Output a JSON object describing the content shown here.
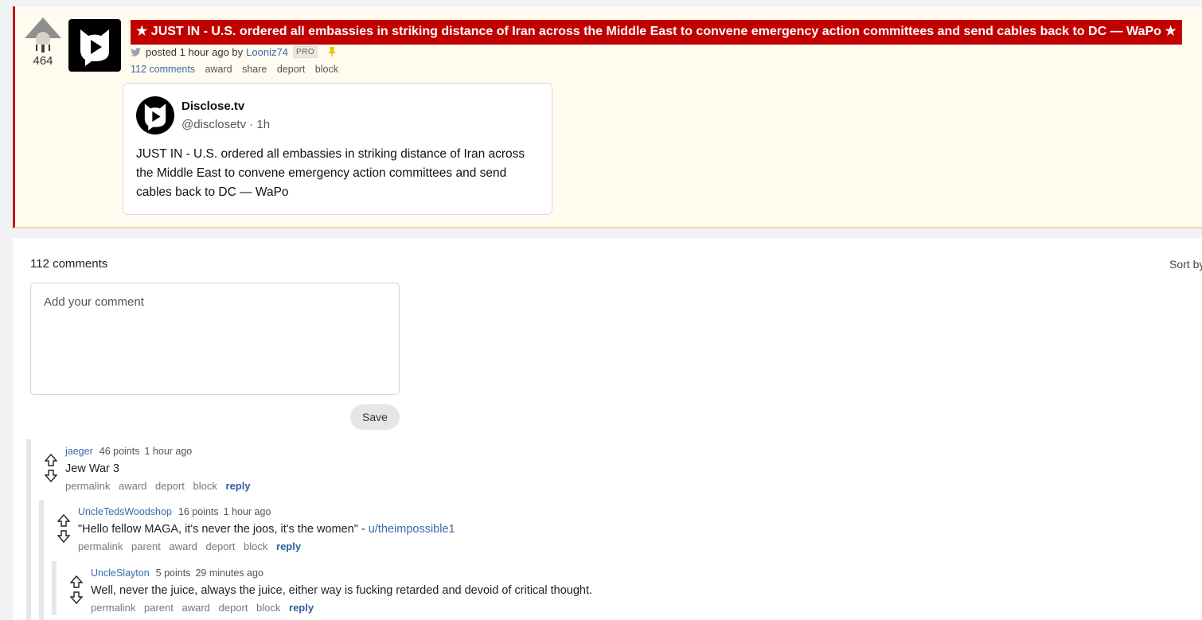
{
  "post": {
    "score": "464",
    "title": "★ JUST IN - U.S. ordered all embassies in striking distance of Iran across the Middle East to convene emergency action committees and send cables back to DC — WaPo ★",
    "posted_text": "posted 1 hour ago by",
    "author": "Looniz74",
    "badge": "PRO",
    "actions": {
      "comments": "112 comments",
      "award": "award",
      "share": "share",
      "deport": "deport",
      "block": "block"
    },
    "tweet": {
      "name": "Disclose.tv",
      "handle": "@disclosetv · 1h",
      "text": "JUST IN - U.S. ordered all embassies in striking distance of Iran across the Middle East to convene emergency action committees and send cables back to DC — WaPo"
    }
  },
  "comments_section": {
    "count_label": "112 comments",
    "sort_label": "Sort by",
    "input_placeholder": "Add your comment",
    "save_label": "Save",
    "comments": [
      {
        "user": "jaeger",
        "points": "46 points",
        "time": "1 hour ago",
        "body": "Jew War 3",
        "actions": [
          "permalink",
          "award",
          "deport",
          "block",
          "reply"
        ]
      },
      {
        "user": "UncleTedsWoodshop",
        "points": "16 points",
        "time": "1 hour ago",
        "body": "\"Hello fellow MAGA, it's never the joos, it's the women\" - ",
        "link": "u/theimpossible1",
        "actions": [
          "permalink",
          "parent",
          "award",
          "deport",
          "block",
          "reply"
        ]
      },
      {
        "user": "UncleSlayton",
        "points": "5 points",
        "time": "29 minutes ago",
        "body": "Well, never the juice, always the juice, either way is fucking retarded and devoid of critical thought.",
        "actions": [
          "permalink",
          "parent",
          "award",
          "deport",
          "block",
          "reply"
        ]
      }
    ]
  },
  "colors": {
    "title_bg": "#c10000",
    "post_bg": "#fffbee",
    "link": "#3a6aa8",
    "accent_border": "#c21a1a"
  },
  "icons": [
    "trump-upvote-icon",
    "disclose-logo-icon",
    "twitter-bird-icon",
    "pin-icon",
    "upvote-arrow-icon",
    "downvote-arrow-icon"
  ]
}
